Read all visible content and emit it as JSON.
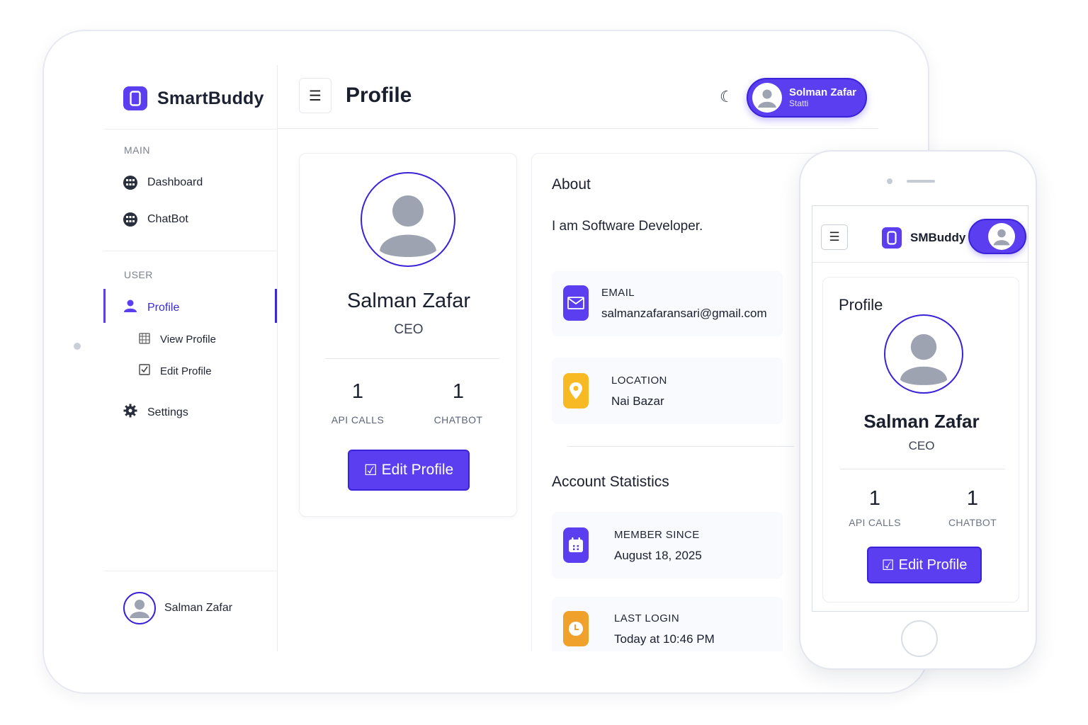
{
  "app": {
    "name": "SmartBuddy",
    "mobile_name": "SMBuddy"
  },
  "colors": {
    "accent": "#5b3ef0",
    "accent_dark": "#3a22d8",
    "location": "#f7b924",
    "login": "#f0a12c"
  },
  "sidebar": {
    "main_title": "MAIN",
    "main_items": [
      {
        "label": "Dashboard",
        "icon": "dashboard-icon"
      },
      {
        "label": "ChatBot",
        "icon": "chatbot-icon"
      }
    ],
    "user_title": "USER",
    "profile_label": "Profile",
    "sub_items": [
      {
        "label": "View Profile",
        "icon": "calendar-grid-icon"
      },
      {
        "label": "Edit Profile",
        "icon": "checkbox-icon"
      }
    ],
    "settings_label": "Settings",
    "footer_user": "Salman Zafar"
  },
  "header": {
    "menu_glyph": "☰",
    "title": "Profile",
    "theme_glyph": "☾",
    "user_name": "Solman Zafar",
    "user_status": "Statti"
  },
  "profile": {
    "name": "Salman Zafar",
    "role": "CEO",
    "stats": [
      {
        "value": "1",
        "label": "API CALLS"
      },
      {
        "value": "1",
        "label": "CHATBOT"
      }
    ],
    "edit_label": "Edit Profile",
    "edit_glyph": "☑"
  },
  "about": {
    "title": "About",
    "text": "I am Software Developer.",
    "email_label": "EMAIL",
    "email": "salmanzafaransari@gmail.com",
    "location_label": "LOCATION",
    "location": "Nai Bazar"
  },
  "account": {
    "title": "Account Statistics",
    "member_label": "MEMBER SINCE",
    "member_value": "August 18, 2025",
    "login_label": "LAST LOGIN",
    "login_value": "Today at 10:46 PM"
  },
  "mobile": {
    "menu_glyph": "☰",
    "card_title": "Profile",
    "name": "Salman Zafar",
    "role": "CEO",
    "stats": [
      {
        "value": "1",
        "label": "API CALLS"
      },
      {
        "value": "1",
        "label": "CHATBOT"
      }
    ],
    "edit_label": "Edit Profile"
  }
}
